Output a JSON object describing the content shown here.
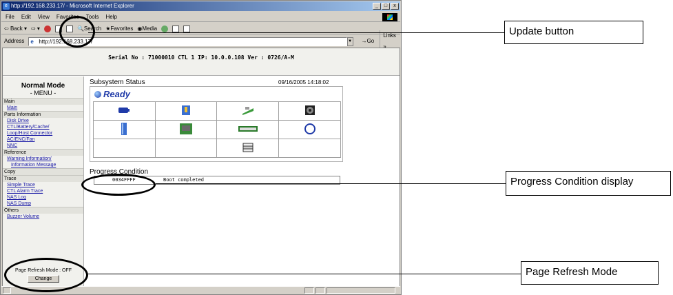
{
  "window": {
    "title": "http://192.168.233.17/ - Microsoft Internet Explorer",
    "controls": [
      "_",
      "□",
      "x"
    ]
  },
  "menubar": [
    "File",
    "Edit",
    "View",
    "Favorites",
    "Tools",
    "Help"
  ],
  "toolbar": {
    "back": "Back",
    "search": "Search",
    "favorites": "Favorites",
    "media": "Media"
  },
  "addressbar": {
    "label": "Address",
    "url": "http://192.168.233.17/",
    "go": "Go",
    "links": "Links"
  },
  "serial_line": "Serial No : 71000010  CTL 1  IP: 10.0.0.108  Ver : 0726/A-M",
  "sidebar": {
    "mode": "Normal Mode",
    "menu": "- MENU -",
    "sections": [
      {
        "title": "Main",
        "links": [
          {
            "label": "Main",
            "indent": false
          }
        ]
      },
      {
        "title": "Parts Information",
        "links": [
          {
            "label": "Disk Drive",
            "indent": false
          },
          {
            "label": "CTL/Battery/Cache/",
            "indent": false
          },
          {
            "label": "Loop/Host Connector",
            "indent": false
          },
          {
            "label": "AC/ENC/Fan",
            "indent": false
          },
          {
            "label": "NNC",
            "indent": false
          }
        ]
      },
      {
        "title": "Reference",
        "links": [
          {
            "label": "Warning Information/",
            "indent": false
          },
          {
            "label": "Information Message",
            "indent": true
          }
        ]
      },
      {
        "title": "Copy",
        "links": []
      },
      {
        "title": "Trace",
        "links": [
          {
            "label": "Simple Trace",
            "indent": false
          },
          {
            "label": "CTL Alarm Trace",
            "indent": false
          },
          {
            "label": "NAS Log",
            "indent": false
          },
          {
            "label": "NAS Dump",
            "indent": false
          }
        ]
      },
      {
        "title": "Others",
        "links": [
          {
            "label": "Buzzer Volume",
            "indent": false
          }
        ]
      }
    ],
    "refresh_mode": "Page Refresh Mode : OFF",
    "change_button": "Change"
  },
  "main": {
    "subsystem_title": "Subsystem Status",
    "date": "09/16/2005 14:18:02",
    "status": "Ready",
    "grid_icons": [
      [
        "battery-icon",
        "power-supply-icon",
        "controller-board-icon",
        "fan-icon"
      ],
      [
        "disk-drive-icon",
        "cache-memory-icon",
        "host-connector-icon",
        "loop-icon"
      ],
      [
        "",
        "",
        "enclosure-icon",
        ""
      ]
    ],
    "progress_title": "Progress Condition",
    "progress_code": "0034FFFF",
    "progress_text": "Boot completed"
  },
  "callouts": {
    "update": "Update button",
    "progress": "Progress Condition display",
    "refresh": "Page Refresh Mode"
  }
}
